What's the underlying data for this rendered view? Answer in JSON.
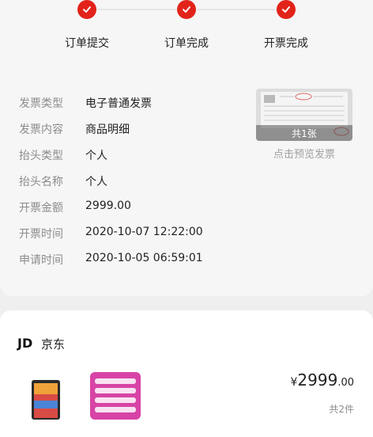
{
  "steps": [
    {
      "label": "订单提交"
    },
    {
      "label": "订单完成"
    },
    {
      "label": "开票完成"
    }
  ],
  "accent_color": "#e2231a",
  "invoice": {
    "rows": [
      {
        "label": "发票类型",
        "value": "电子普通发票"
      },
      {
        "label": "发票内容",
        "value": "商品明细"
      },
      {
        "label": "抬头类型",
        "value": "个人"
      },
      {
        "label": "抬头名称",
        "value": "个人"
      },
      {
        "label": "开票金额",
        "value": "2999.00"
      },
      {
        "label": "开票时间",
        "value": "2020-10-07 12:22:00"
      },
      {
        "label": "申请时间",
        "value": "2020-10-05 06:59:01"
      }
    ],
    "preview": {
      "caption": "共1张",
      "link": "点击预览发票"
    }
  },
  "shop": {
    "logo": "JD",
    "name": "京东",
    "price_currency": "¥",
    "price_int": "2999",
    "price_dec": ".00",
    "count": "共2件"
  }
}
